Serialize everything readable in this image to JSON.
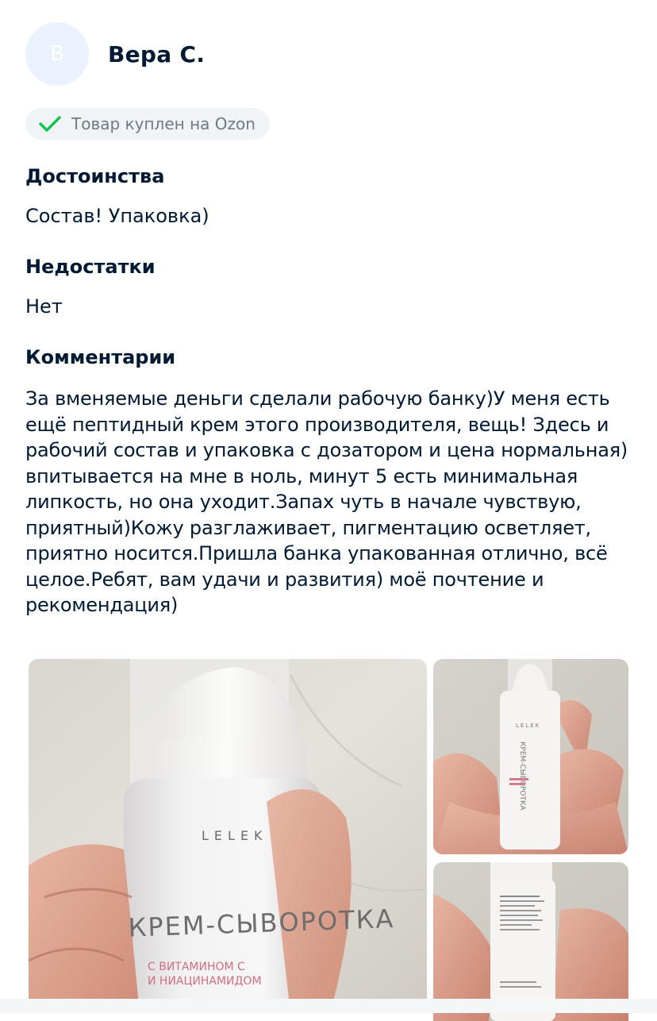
{
  "review": {
    "avatar_letter": "В",
    "author": "Вера С.",
    "badge_text": "Товар куплен на Ozon",
    "pros_title": "Достоинства",
    "pros_text": "Состав! Упаковка)",
    "cons_title": "Недостатки",
    "cons_text": "Нет",
    "comment_title": "Комментарии",
    "comment_text": "За вменяемые деньги сделали рабочую банку)У меня есть ещё пептидный крем этого производителя, вещь! Здесь и рабочий состав и упаковка с дозатором и цена нормальная) впитывается на мне в ноль, минут 5 есть минимальная липкость, но она уходит.Запах чуть в начале чувствую, приятный)Кожу разглаживает, пигментацию осветляет, приятно носится.Пришла банка упакованная отлично, всё целое.Ребят, вам удачи и развития) моё почтение и рекомендация)"
  },
  "photos": {
    "main": {
      "brand": "LELEK",
      "product": "КРЕМ-СЫВОРОТКА",
      "sub1": "С ВИТАМИНОМ С",
      "sub2": "И НИАЦИНАМИДОМ"
    },
    "side1": {
      "brand": "LELEK",
      "product": "КРЕМ-СЫВОРОТКА"
    }
  },
  "colors": {
    "check": "#10c44c",
    "badge_bg": "#f1f4f7",
    "avatar_bg": "#eaf3fd",
    "text": "#001a34"
  }
}
